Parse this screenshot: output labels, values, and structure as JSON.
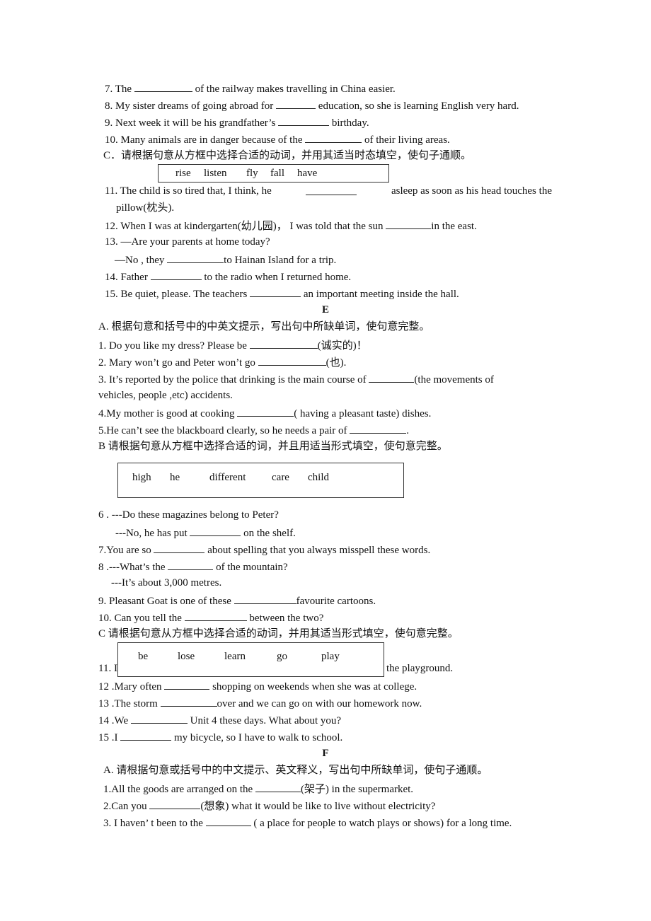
{
  "sectionD_part2": {
    "q7": {
      "pre": "7. The ",
      "post": " of the railway makes travelling in China easier."
    },
    "q8": {
      "pre": "8. My sister dreams of going abroad for ",
      "post": " education, so she is learning English very hard."
    },
    "q9": {
      "pre": "9. Next week it will be his grandfather’s ",
      "post": " birthday."
    },
    "q10": {
      "pre": "10. Many animals are in danger because of the ",
      "post": " of their living areas."
    },
    "partC_instruction": "C．请根据句意从方框中选择合适的动词，并用其适当时态填空，使句子通顺。",
    "partC_words": [
      "rise",
      "listen",
      "fly",
      "fall",
      "have"
    ],
    "q11": {
      "line1_pre": "11. The child is so tired that, I think, he",
      "line1_post": "asleep as soon as his head touches the",
      "line2": "pillow(枕头)."
    },
    "q12": {
      "pre": "12. When I was at kindergarten(幼儿园)，  I was told that the sun ",
      "post": "in the east."
    },
    "q13": {
      "line1": "13. —Are your parents at home today?",
      "line2_pre": "—No , they ",
      "line2_post": "to Hainan Island for a trip."
    },
    "q14": {
      "pre": "14. Father ",
      "post": " to the radio when I returned home."
    },
    "q15": {
      "pre": "15. Be quiet, please. The teachers ",
      "post": " an important meeting inside the hall."
    }
  },
  "sectionE": {
    "heading": "E",
    "partA_instruction": "A. 根据句意和括号中的中英文提示，写出句中所缺单词，使句意完整。",
    "q1": {
      "pre": "1. Do you like my dress?    Please be ",
      "post": "(诚实的)！"
    },
    "q2": {
      "pre": "2. Mary won’t go and Peter won’t go    ",
      "post": "(也)."
    },
    "q3": {
      "line1_pre": "3. It’s reported by the police that drinking is the main course of ",
      "line1_post": "(the movements of",
      "line2": "vehicles, people ,etc) accidents."
    },
    "q4": {
      "pre": "4.My mother is good at cooking ",
      "post": "( having a pleasant taste) dishes."
    },
    "q5": {
      "pre": "5.He can’t see the blackboard clearly, so he needs a pair of ",
      "post": "."
    },
    "partB_instruction": "B  请根据句意从方框中选择合适的词，并且用适当形式填空，使句意完整。",
    "partB_words": [
      "high",
      "he",
      "different",
      "care",
      "child"
    ],
    "q6": {
      "line1": "6 . ---Do these magazines belong to Peter?",
      "line2_pre": "---No, he has put    ",
      "line2_post": "    on the shelf."
    },
    "q7": {
      "pre": "7.You are so ",
      "post": " about spelling that you always misspell these words."
    },
    "q8": {
      "line1_pre": "8 .---What’s the    ",
      "line1_post": "    of the mountain?",
      "line2": "---It’s about 3,000 metres."
    },
    "q9": {
      "pre": "9. Pleasant Goat is one of these ",
      "post": "favourite cartoons."
    },
    "q10": {
      "pre": "10. Can you tell the ",
      "post": " between the two?"
    },
    "partC_instruction": "C    请根据句意从方框中选择合适的动词，并用其适当形式填空，使句意完整。",
    "partC_words": [
      "be",
      "lose",
      "learn",
      "go",
      "play"
    ],
    "q11": {
      "pre": "11. I",
      "post": "the playground."
    },
    "q12": {
      "pre": "12 .Mary often    ",
      "post": " shopping on weekends when she was at college."
    },
    "q13": {
      "pre": "13 .The storm    ",
      "post": "over and we can go on with our homework now."
    },
    "q14": {
      "pre": "14 .We ",
      "post": " Unit 4 these days. What about you?"
    },
    "q15": {
      "pre": "15 .I ",
      "post": " my bicycle, so I have to walk to school."
    }
  },
  "sectionF": {
    "heading": "F",
    "partA_instruction": "A.   请根据句意或括号中的中文提示、英文释义，写出句中所缺单词，使句子通顺。",
    "q1": {
      "pre": "1.All the goods are arranged on the ",
      "post": "(架子) in the supermarket."
    },
    "q2": {
      "pre": "2.Can you ",
      "post": "(想象) what it would be like to live without electricity?"
    },
    "q3": {
      "pre": "3. I haven’ t been to the ",
      "post": " ( a place for people to watch plays or shows) for a long time."
    }
  }
}
